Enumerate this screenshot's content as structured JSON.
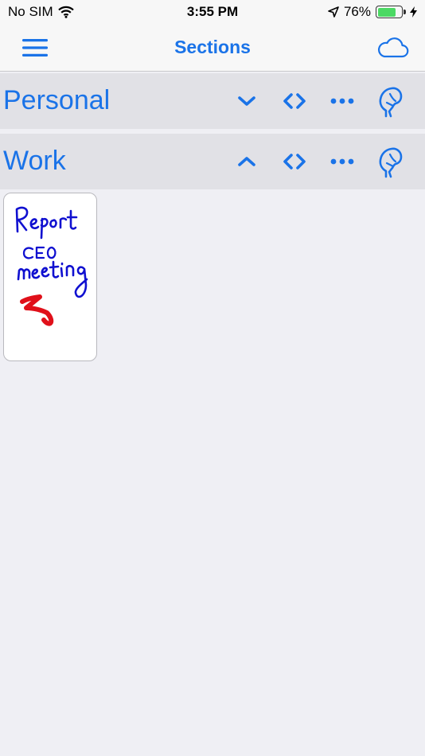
{
  "status_bar": {
    "carrier": "No SIM",
    "time": "3:55 PM",
    "battery_percent": "76%",
    "battery_level": 0.76
  },
  "nav": {
    "title": "Sections",
    "menu_icon": "hamburger-icon",
    "cloud_icon": "cloud-icon"
  },
  "sections": [
    {
      "name": "Personal",
      "expanded": false
    },
    {
      "name": "Work",
      "expanded": true
    }
  ],
  "note": {
    "handwriting": "Report CEO meeting"
  },
  "colors": {
    "accent": "#1a73e8",
    "background": "#efeff4",
    "section_bg": "#e1e1e6",
    "ink_blue": "#1010d0",
    "ink_red": "#e0101a"
  }
}
